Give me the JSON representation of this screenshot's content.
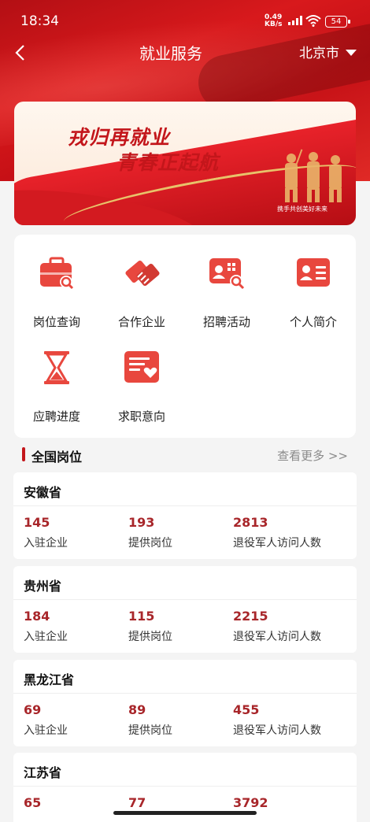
{
  "status": {
    "time": "18:34",
    "net_speed_top": "0.49",
    "net_speed_bottom": "KB/s",
    "battery": "54"
  },
  "nav": {
    "title": "就业服务",
    "city": "北京市"
  },
  "banner": {
    "line1": "戎归再就业",
    "line2": "青春正起航",
    "slogan": "携手共创美好未来"
  },
  "services": [
    {
      "label": "岗位查询",
      "icon": "briefcase-search-icon"
    },
    {
      "label": "合作企业",
      "icon": "handshake-icon"
    },
    {
      "label": "招聘活动",
      "icon": "recruit-search-icon"
    },
    {
      "label": "个人简介",
      "icon": "id-card-icon"
    },
    {
      "label": "应聘进度",
      "icon": "hourglass-icon"
    },
    {
      "label": "求职意向",
      "icon": "heart-form-icon"
    }
  ],
  "section": {
    "title": "全国岗位",
    "more": "查看更多 >>"
  },
  "labels": {
    "companies": "入驻企业",
    "positions": "提供岗位",
    "visitors": "退役军人访问人数"
  },
  "provinces": [
    {
      "name": "安徽省",
      "companies": "145",
      "positions": "193",
      "visitors": "2813"
    },
    {
      "name": "贵州省",
      "companies": "184",
      "positions": "115",
      "visitors": "2215"
    },
    {
      "name": "黑龙江省",
      "companies": "69",
      "positions": "89",
      "visitors": "455"
    },
    {
      "name": "江苏省",
      "companies": "65",
      "positions": "77",
      "visitors": "3792"
    }
  ],
  "colors": {
    "brand_red": "#c3161b",
    "value_red": "#a8262a",
    "icon_red": "#e8473e"
  }
}
